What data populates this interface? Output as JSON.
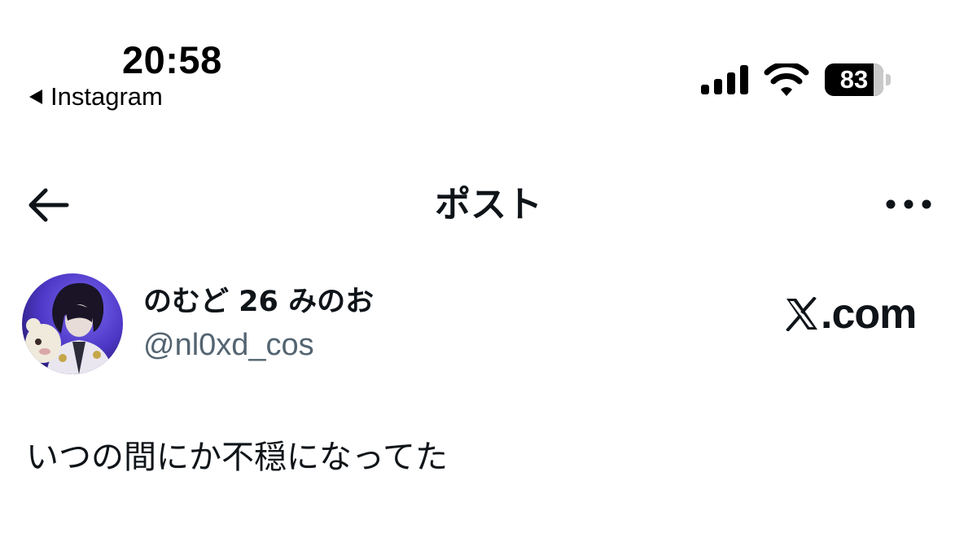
{
  "status_bar": {
    "time": "20:58",
    "back_app_label": "Instagram",
    "battery_percent": "83",
    "battery_level": 0.83,
    "icons": [
      "cellular-signal-icon",
      "wifi-icon",
      "battery-icon"
    ]
  },
  "header": {
    "title": "ポスト",
    "back_icon": "arrow-left-icon",
    "more_icon": "more-horizontal-icon"
  },
  "post": {
    "author": {
      "display_name": "のむど 26 みのお",
      "handle": "@nl0xd_cos"
    },
    "source_brand": "𝕏.com",
    "source_brand_suffix": ".com",
    "text": "いつの間にか不穏になってた"
  },
  "colors": {
    "text_primary": "#0f1419",
    "text_secondary": "#536471",
    "background": "#ffffff",
    "avatar_bg": "#5b45d8"
  }
}
